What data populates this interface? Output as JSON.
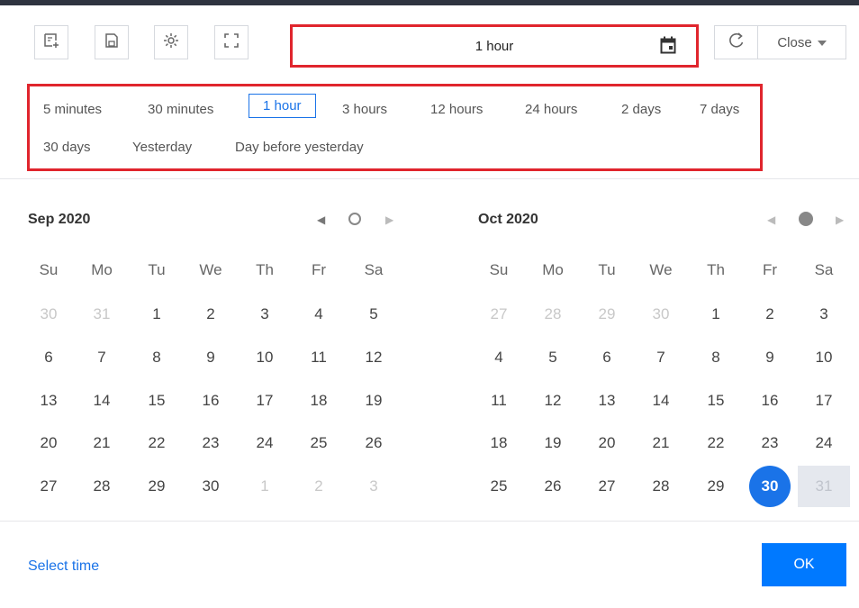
{
  "toolbar": {
    "icons": [
      "add-panel-icon",
      "save-icon",
      "settings-icon",
      "fullscreen-icon",
      "calendar-icon",
      "refresh-icon"
    ],
    "range_value": "1 hour",
    "close_label": "Close"
  },
  "quick_ranges": {
    "items": [
      "5 minutes",
      "30 minutes",
      "1 hour",
      "3 hours",
      "12 hours",
      "24 hours",
      "2 days",
      "7 days",
      "30 days",
      "Yesterday",
      "Day before yesterday"
    ],
    "active": "1 hour"
  },
  "calendars": [
    {
      "title": "Sep 2020",
      "weekdays": [
        "Su",
        "Mo",
        "Tu",
        "We",
        "Th",
        "Fr",
        "Sa"
      ],
      "weeks": [
        [
          "30",
          "31",
          "1",
          "2",
          "3",
          "4",
          "5"
        ],
        [
          "6",
          "7",
          "8",
          "9",
          "10",
          "11",
          "12"
        ],
        [
          "13",
          "14",
          "15",
          "16",
          "17",
          "18",
          "19"
        ],
        [
          "20",
          "21",
          "22",
          "23",
          "24",
          "25",
          "26"
        ],
        [
          "27",
          "28",
          "29",
          "30",
          "1",
          "2",
          "3"
        ]
      ]
    },
    {
      "title": "Oct 2020",
      "weekdays": [
        "Su",
        "Mo",
        "Tu",
        "We",
        "Th",
        "Fr",
        "Sa"
      ],
      "weeks": [
        [
          "27",
          "28",
          "29",
          "30",
          "1",
          "2",
          "3"
        ],
        [
          "4",
          "5",
          "6",
          "7",
          "8",
          "9",
          "10"
        ],
        [
          "11",
          "12",
          "13",
          "14",
          "15",
          "16",
          "17"
        ],
        [
          "18",
          "19",
          "20",
          "21",
          "22",
          "23",
          "24"
        ],
        [
          "25",
          "26",
          "27",
          "28",
          "29",
          "30",
          "31"
        ]
      ],
      "selected_day": "30"
    }
  ],
  "footer": {
    "select_time_label": "Select time",
    "ok_label": "OK"
  },
  "colors": {
    "accent": "#1a73e8",
    "ok_button": "#0079ff",
    "highlight_border": "#e0252d"
  }
}
